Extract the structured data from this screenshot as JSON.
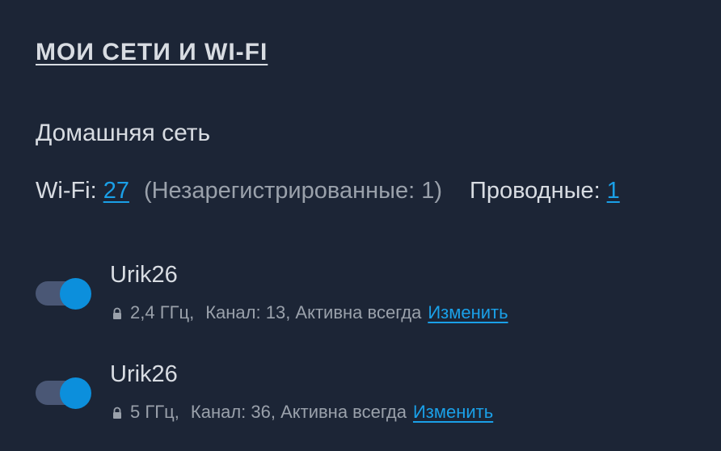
{
  "header": {
    "title": "МОИ СЕТИ И WI-FI"
  },
  "network": {
    "name": "Домашняя сеть",
    "wifi_label": "Wi-Fi:",
    "wifi_count": "27",
    "unregistered_text": "(Незарегистрированные: 1)",
    "wired_label": "Проводные:",
    "wired_count": "1"
  },
  "wifi_networks": [
    {
      "ssid": "Urik26",
      "band": "2,4 ГГц,",
      "details": "Канал: 13, Активна всегда",
      "edit_label": "Изменить",
      "enabled": true,
      "lock_icon": "lock-icon"
    },
    {
      "ssid": "Urik26",
      "band": "5 ГГц,",
      "details": "Канал: 36, Активна всегда",
      "edit_label": "Изменить",
      "enabled": true,
      "lock_icon": "lock-icon"
    }
  ],
  "colors": {
    "background": "#1c2536",
    "text": "#d8dce2",
    "muted": "#9aa1ab",
    "link": "#1aa0e8",
    "toggle_track": "#4a5775",
    "toggle_knob": "#0c8fdc"
  }
}
